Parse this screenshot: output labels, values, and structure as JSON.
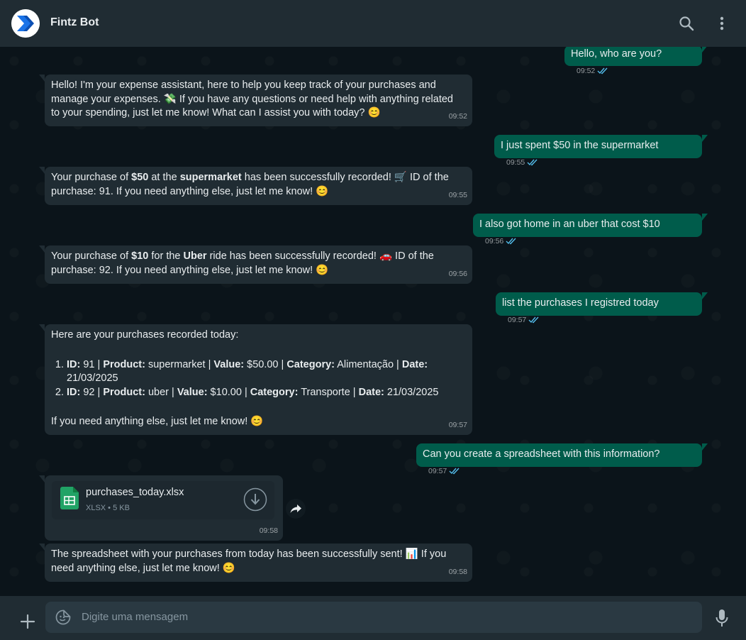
{
  "header": {
    "title": "Fintz Bot",
    "icons": [
      "logo-icon",
      "search-icon",
      "more-vertical-icon"
    ]
  },
  "messages": {
    "m1": {
      "text": "Hello, who are you?",
      "time": "09:52"
    },
    "m2": {
      "text": "Hello! I'm your expense assistant, here to help you keep track of your purchases and manage your expenses. 💸 If you have any questions or need help with anything related to your spending, just let me know! What can I assist you with today? 😊",
      "time": "09:52"
    },
    "m3": {
      "text": "I just spent $50 in the supermarket",
      "time": "09:55"
    },
    "m4": {
      "p1": "Your purchase of ",
      "b1": "$50",
      "p2": " at the ",
      "b2": "supermarket",
      "p3": " has been successfully recorded! 🛒 ID of the purchase: 91. If you need anything else, just let me know! 😊",
      "time": "09:55"
    },
    "m5": {
      "text": "I also got home in an uber that cost $10",
      "time": "09:56"
    },
    "m6": {
      "p1": "Your purchase of ",
      "b1": "$10",
      "p2": " for the ",
      "b2": "Uber",
      "p3": " ride has been successfully recorded! 🚗 ID of the purchase: 92. If you need anything else, just let me know! 😊",
      "time": "09:56"
    },
    "m7": {
      "text": "list the purchases I registred today",
      "time": "09:57"
    },
    "m8": {
      "intro": "Here are your purchases recorded today:",
      "items": [
        {
          "id_label": "ID:",
          "id": " 91 | ",
          "product_label": "Product:",
          "product": " supermarket | ",
          "value_label": "Value:",
          "value": " $50.00 | ",
          "category_label": "Category:",
          "category": " Alimentação | ",
          "date_label": "Date:",
          "date": " 21/03/2025"
        },
        {
          "id_label": "ID:",
          "id": " 92 | ",
          "product_label": "Product:",
          "product": " uber | ",
          "value_label": "Value:",
          "value": " $10.00 | ",
          "category_label": "Category:",
          "category": " Transporte | ",
          "date_label": "Date:",
          "date": " 21/03/2025"
        }
      ],
      "outro": "If you need anything else, just let me know! 😊",
      "time": "09:57"
    },
    "m9": {
      "text": "Can you create a spreadsheet with this information?",
      "time": "09:57"
    },
    "m10": {
      "file_name": "purchases_today.xlsx",
      "file_meta": "XLSX • 5 KB",
      "time": "09:58"
    },
    "m11": {
      "text": "The spreadsheet with your purchases from today has been successfully sent! 📊 If you need anything else, just let me know! 😊",
      "time": "09:58"
    }
  },
  "composer": {
    "placeholder": "Digite uma mensagem"
  },
  "colors": {
    "background": "#0b141a",
    "header": "#202c33",
    "incoming_bubble": "#202c33",
    "outgoing_bubble": "#005c4b",
    "read_tick": "#53bdeb",
    "spreadsheet_green": "#21a366"
  }
}
